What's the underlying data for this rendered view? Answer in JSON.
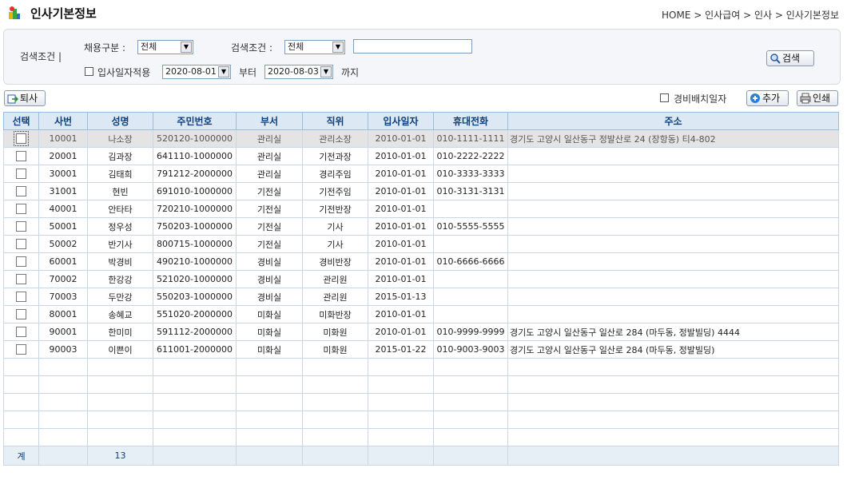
{
  "header": {
    "title": "인사기본정보",
    "breadcrumb": [
      "HOME",
      " > ",
      "인사급여",
      " > ",
      "인사",
      " > ",
      "인사기본정보"
    ]
  },
  "search": {
    "section_label": "검색조건 |",
    "hire_type_label": "채용구분 :",
    "hire_type_value": "전체",
    "condition_label": "검색조건 :",
    "condition_value": "전체",
    "keyword_value": "",
    "apply_hire_date_label": "입사일자적용",
    "date_from": "2020-08-01",
    "from_label": "부터",
    "date_to": "2020-08-03",
    "to_label": "까지",
    "search_button": "검색"
  },
  "toolbar": {
    "retire_button": "퇴사",
    "guard_date_label": "경비배치일자",
    "add_button": "추가",
    "print_button": "인쇄"
  },
  "table": {
    "columns": [
      "선택",
      "사번",
      "성명",
      "주민번호",
      "부서",
      "직위",
      "입사일자",
      "휴대전화",
      "주소"
    ],
    "rows": [
      {
        "id": "10001",
        "name": "나소장",
        "rrn": "520120-1000000",
        "dept": "관리실",
        "position": "관리소장",
        "hired": "2010-01-01",
        "phone": "010-1111-1111",
        "address": "경기도 고양시 일산동구 정발산로 24 (장항동) 티4-802"
      },
      {
        "id": "20001",
        "name": "김과장",
        "rrn": "641110-1000000",
        "dept": "관리실",
        "position": "기전과장",
        "hired": "2010-01-01",
        "phone": "010-2222-2222",
        "address": ""
      },
      {
        "id": "30001",
        "name": "김태희",
        "rrn": "791212-2000000",
        "dept": "관리실",
        "position": "경리주임",
        "hired": "2010-01-01",
        "phone": "010-3333-3333",
        "address": ""
      },
      {
        "id": "31001",
        "name": "현빈",
        "rrn": "691010-1000000",
        "dept": "기전실",
        "position": "기전주임",
        "hired": "2010-01-01",
        "phone": "010-3131-3131",
        "address": ""
      },
      {
        "id": "40001",
        "name": "안타타",
        "rrn": "720210-1000000",
        "dept": "기전실",
        "position": "기전반장",
        "hired": "2010-01-01",
        "phone": "",
        "address": ""
      },
      {
        "id": "50001",
        "name": "정우성",
        "rrn": "750203-1000000",
        "dept": "기전실",
        "position": "기사",
        "hired": "2010-01-01",
        "phone": "010-5555-5555",
        "address": ""
      },
      {
        "id": "50002",
        "name": "반기사",
        "rrn": "800715-1000000",
        "dept": "기전실",
        "position": "기사",
        "hired": "2010-01-01",
        "phone": "",
        "address": ""
      },
      {
        "id": "60001",
        "name": "박경비",
        "rrn": "490210-1000000",
        "dept": "경비실",
        "position": "경비반장",
        "hired": "2010-01-01",
        "phone": "010-6666-6666",
        "address": ""
      },
      {
        "id": "70002",
        "name": "한강강",
        "rrn": "521020-1000000",
        "dept": "경비실",
        "position": "관리원",
        "hired": "2010-01-01",
        "phone": "",
        "address": ""
      },
      {
        "id": "70003",
        "name": "두만강",
        "rrn": "550203-1000000",
        "dept": "경비실",
        "position": "관리원",
        "hired": "2015-01-13",
        "phone": "",
        "address": ""
      },
      {
        "id": "80001",
        "name": "송혜교",
        "rrn": "551020-2000000",
        "dept": "미화실",
        "position": "미화반장",
        "hired": "2010-01-01",
        "phone": "",
        "address": ""
      },
      {
        "id": "90001",
        "name": "한미미",
        "rrn": "591112-2000000",
        "dept": "미화실",
        "position": "미화원",
        "hired": "2010-01-01",
        "phone": "010-9999-9999",
        "address": "경기도 고양시 일산동구 일산로 284 (마두동, 정발빌딩) 4444"
      },
      {
        "id": "90003",
        "name": "이쁜이",
        "rrn": "611001-2000000",
        "dept": "미화실",
        "position": "미화원",
        "hired": "2015-01-22",
        "phone": "010-9003-9003",
        "address": "경기도 고양시 일산동구 일산로 284 (마두동, 정발빌딩)"
      }
    ],
    "footer": {
      "label": "계",
      "count": "13"
    }
  }
}
